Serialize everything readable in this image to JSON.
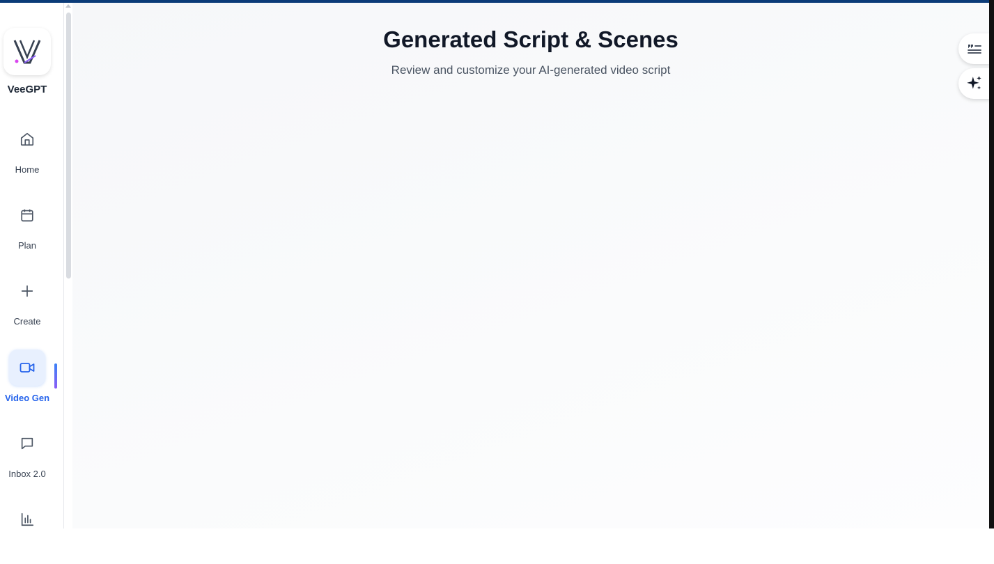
{
  "app": {
    "name": "VeeGPT"
  },
  "sidebar": {
    "items": [
      {
        "label": "Home",
        "icon": "home-icon"
      },
      {
        "label": "Plan",
        "icon": "calendar-icon"
      },
      {
        "label": "Create",
        "icon": "plus-icon"
      },
      {
        "label": "Video Gen",
        "icon": "video-icon",
        "active": true
      },
      {
        "label": "Inbox 2.0",
        "icon": "message-icon"
      },
      {
        "label": "",
        "icon": "bar-chart-icon"
      }
    ]
  },
  "main": {
    "title": "Generated Script & Scenes",
    "subtitle": "Review and customize your AI-generated video script"
  },
  "floating": {
    "buttons": [
      {
        "icon": "quote-list-icon"
      },
      {
        "icon": "sparkles-icon"
      }
    ]
  },
  "colors": {
    "accent": "#2563eb",
    "topbar": "#0b3b78",
    "indicator_start": "#3b82f6",
    "indicator_end": "#8b5cf6"
  }
}
